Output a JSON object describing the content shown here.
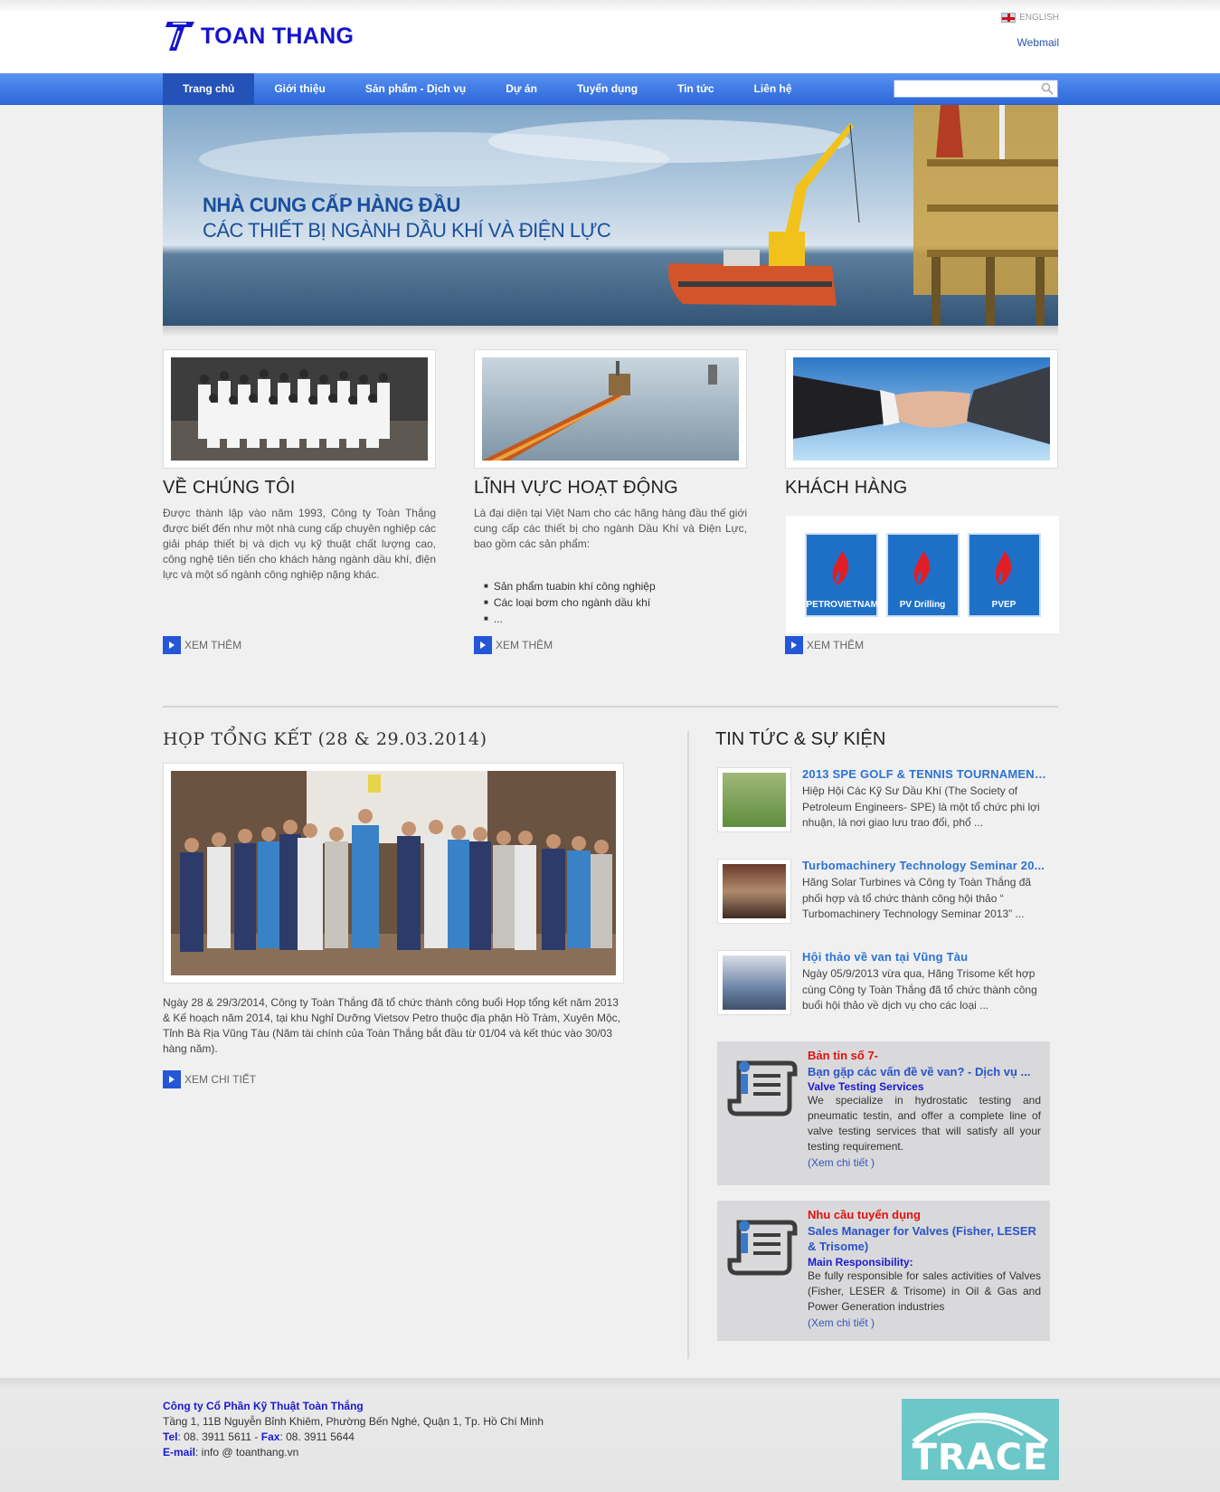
{
  "header": {
    "logo_text": "TOAN THANG",
    "language": "ENGLISH",
    "webmail": "Webmail"
  },
  "nav": {
    "items": [
      "Trang chủ",
      "Giới thiệu",
      "Sản phẩm - Dịch vụ",
      "Dự án",
      "Tuyển dụng",
      "Tin tức",
      "Liên hệ"
    ],
    "active": "Trang chủ",
    "search_placeholder": ""
  },
  "banner": {
    "line1": "NHÀ CUNG CẤP HÀNG ĐẦU",
    "line2": "CÁC THIẾT BỊ NGÀNH DẦU KHÍ VÀ ĐIỆN LỰC"
  },
  "features": {
    "about": {
      "title": "VỀ CHÚNG TÔI",
      "text": "Được thành lập vào năm 1993, Công ty Toàn Thắng được biết đến như một nhà cung cấp chuyên nghiệp các giải pháp thiết bị và dịch vụ kỹ thuật chất lượng cao, công nghệ tiên tiến cho khách hàng ngành dầu khí, điện lực và một số ngành công nghiệp nặng khác.",
      "more": "XEM THÊM"
    },
    "fields": {
      "title": "LĨNH VỰC HOẠT ĐỘNG",
      "text": "Là đại diện tại Việt Nam cho các hãng hàng đầu thế giới cung cấp các thiết bị cho ngành Dầu Khí và Điện Lực, bao gồm các sản phẩm:",
      "bullets": [
        "Sản phẩm tuabin khí công nghiệp",
        "Các loại bơm cho ngành dầu khí",
        "..."
      ],
      "more": "XEM THÊM"
    },
    "clients": {
      "title": "KHÁCH HÀNG",
      "logos": [
        "PETROVIETNAM",
        "PV Drilling",
        "PVEP"
      ],
      "more": "XEM THÊM"
    }
  },
  "event": {
    "title": "HỌP TỔNG KẾT (28 & 29.03.2014)",
    "text": "Ngày 28 & 29/3/2014, Công ty Toàn Thắng đã tổ chức thành công buổi Họp tổng kết năm 2013 & Kế hoạch năm 2014, tại khu Nghỉ Dưỡng Vietsov Petro thuộc địa phận Hồ Tràm, Xuyên Mộc, Tỉnh Bà Rịa Vũng Tàu (Năm tài chính của Toàn Thắng bắt đầu từ 01/04 và kết thúc vào 30/03 hàng năm).",
    "more": "XEM CHI TIẾT"
  },
  "news": {
    "title": "TIN TỨC & SỰ KIỆN",
    "items": [
      {
        "title": "2013 SPE GOLF & TENNIS TOURNAMENT ...",
        "text": "Hiệp Hội Các Kỹ Sư Dầu Khí (The Society of Petroleum Engineers- SPE) là một tổ chức phi lợi nhuận, là nơi giao lưu trao đổi, phổ ..."
      },
      {
        "title": "Turbomachinery Technology Seminar 20...",
        "text": "Hãng Solar Turbines và Công ty Toàn Thắng đã phối hợp và tổ chức thành công hội thảo “ Turbomachinery Technology Seminar 2013” ..."
      },
      {
        "title": "Hội thảo về van tại Vũng Tàu",
        "text": "Ngày 05/9/2013 vừa qua, Hãng Trisome kết hợp cùng Công ty Toàn Thắng đã tổ chức thành công buổi hội thảo về dịch vụ cho các loại ..."
      }
    ]
  },
  "notices": [
    {
      "red": "Bản tin số 7-",
      "blue": "Bạn gặp các vấn đề về van? - Dịch vụ ...",
      "sub": "Valve Testing Services",
      "text": "We specialize in hydrostatic testing and pneumatic testin, and offer a complete line of valve testing services that will satisfy all your testing requirement.",
      "link": "(Xem chi tiết )"
    },
    {
      "red": "Nhu cầu tuyển dụng",
      "blue": "Sales Manager for Valves (Fisher, LESER & Trisome)",
      "sub": "Main Responsibility:",
      "text": "Be fully responsible for sales activities of Valves (Fisher, LESER & Trisome) in Oil & Gas and Power Generation industries",
      "link": "(Xem chi tiết )"
    }
  ],
  "footer": {
    "company": "Công ty Cổ Phần Kỹ Thuật Toàn Thắng",
    "address": "Tầng 1, 11B Nguyễn Bỉnh Khiêm, Phường Bến Nghé, Quận 1, Tp. Hồ Chí Minh",
    "tel_label": "Tel",
    "tel": ": 08. 3911 5611 - ",
    "fax_label": "Fax",
    "fax": ": 08. 3911 5644",
    "email_label": "E-mail",
    "email": ": info @ toanthang.vn",
    "partner_logo": "TRACE"
  },
  "colors": {
    "brand_blue": "#1414cc",
    "nav_blue": "#3c77e4",
    "link_blue": "#2a73d4",
    "alert_red": "#e01010",
    "trace_teal": "#6cc7c8"
  }
}
